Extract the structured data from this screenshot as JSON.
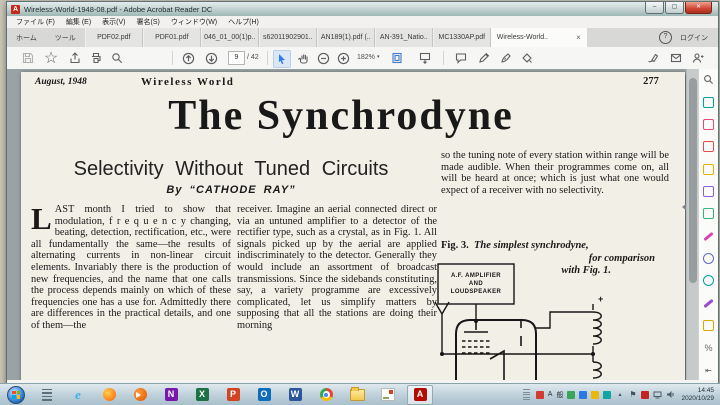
{
  "window": {
    "title": "Wireless-World-1948-08.pdf - Adobe Acrobat Reader DC",
    "app_icon_letter": "A"
  },
  "glyphs": {
    "minimize": "–",
    "maximize": "▢",
    "close": "✕",
    "star": "☆",
    "caret": "▾",
    "percent": "%",
    "panel_expand": "⇤",
    "tray_arrow": "▴",
    "tray_flag": "⚑"
  },
  "menu": {
    "items": [
      "ファイル (F)",
      "編集 (E)",
      "表示(V)",
      "署名(S)",
      "ウィンドウ(W)",
      "ヘルプ(H)"
    ]
  },
  "tabbar": {
    "home": "ホーム",
    "tools": "ツール",
    "docs": [
      "PDF02.pdf",
      "PDF01.pdf",
      "046_01_00(1)p..",
      "s62011902901..",
      "AN189(1).pdf (..",
      "AN-391_Natio..",
      "MC1330AP.pdf"
    ],
    "active": "Wireless-World..",
    "close": "×",
    "help": "?",
    "login": "ログイン"
  },
  "toolbar": {
    "page_current": "9",
    "page_total": "/ 42",
    "zoom": "182%"
  },
  "tools_panel": {
    "items": [
      "search",
      "export-pdf",
      "create-pdf",
      "edit-pdf",
      "comment",
      "combine-files",
      "organize-pages",
      "fill-and-sign",
      "protect",
      "compress-pdf",
      "certificates",
      "stamp",
      "measure"
    ]
  },
  "document": {
    "header": {
      "issue_date": "August, 1948",
      "magazine": "Wireless World",
      "page_number": "277"
    },
    "title": "The Synchrodyne",
    "subtitle": "Selectivity  Without  Tuned  Circuits",
    "byline": "By “CATHODE  RAY”",
    "columns": {
      "col1_dropcap": "L",
      "col1": "AST month I tried to show that modulation, f r e q u e n c y changing, beating, detection, rectification, etc., were all fundamentally the same—the results of alternating currents in non-linear circuit elements.  Invariably there is the production of new frequencies, and the name that one calls the process depends mainly on which of these frequencies one has a use for.  Admittedly there are differences in the practical details, and one of them—the",
      "col2": "receiver.  Imagine an aerial connected direct or via an untuned amplifier to a detector of the rectifier type, such as a crystal, as in Fig. 1.  All signals picked up by the aerial are applied indiscriminately to the detector.  Generally they would include an assortment of broadcast transmissions.  Since the sidebands constituting, say, a variety programme are excessively complicated, let us simplify matters by supposing that all the stations are doing their morning",
      "col3": "so the tuning note of every station within range will be made audible. When their programmes come on, all will be heard at once; which is just what one would expect of a receiver with no selectivity."
    },
    "figure": {
      "label": "Fig. 3.",
      "caption_line1": "The simplest synchrodyne,",
      "caption_line2": "for comparison",
      "caption_line3": "with Fig. 1.",
      "box_line1": "A.F. AMPLIFIER",
      "box_line2": "AND",
      "box_line3": "LOUDSPEAKER",
      "plus": "+"
    }
  },
  "taskbar": {
    "app_glyphs": {
      "ie": "e",
      "onenote": "N",
      "excel": "X",
      "powerpoint": "P",
      "outlook": "O",
      "word": "W",
      "acrobat": "A"
    },
    "tray": {
      "ime_direct": "A",
      "ime_mode": "般",
      "time": "14:45",
      "date": "2020/10/29"
    }
  }
}
